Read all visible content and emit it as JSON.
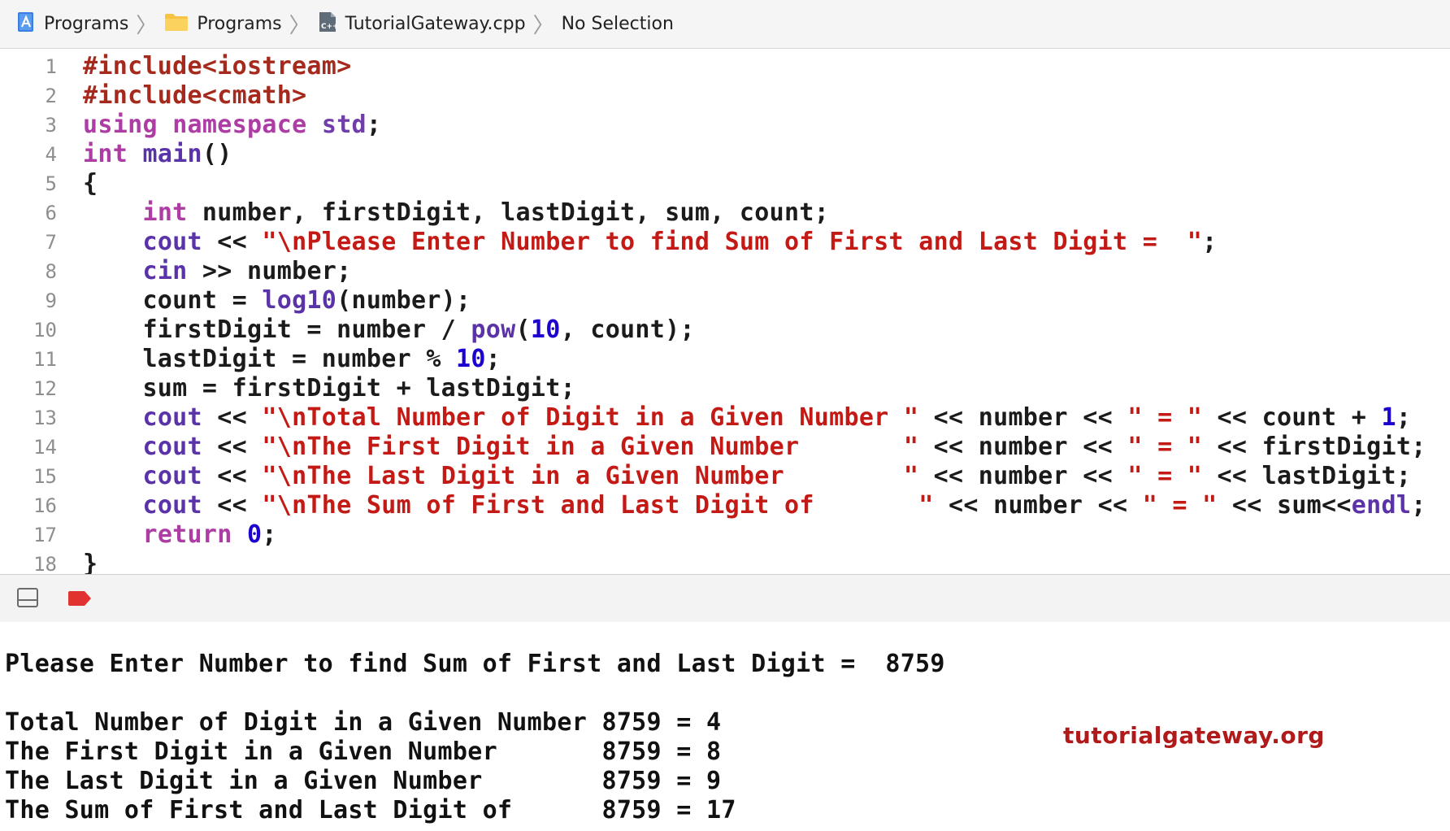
{
  "breadcrumb": {
    "items": [
      {
        "label": "Programs",
        "icon": "xcode-project-icon"
      },
      {
        "label": "Programs",
        "icon": "folder-icon"
      },
      {
        "label": "TutorialGateway.cpp",
        "icon": "cpp-file-icon"
      },
      {
        "label": "No Selection",
        "icon": ""
      }
    ],
    "separator": "〉"
  },
  "editor": {
    "line_numbers": [
      "1",
      "2",
      "3",
      "4",
      "5",
      "6",
      "7",
      "8",
      "9",
      "10",
      "11",
      "12",
      "13",
      "14",
      "15",
      "16",
      "17",
      "18"
    ],
    "lines": [
      [
        {
          "t": "#include<iostream>",
          "c": "hash"
        }
      ],
      [
        {
          "t": "#include<cmath>",
          "c": "hash"
        }
      ],
      [
        {
          "t": "using",
          "c": "kw"
        },
        {
          "t": " "
        },
        {
          "t": "namespace",
          "c": "kw"
        },
        {
          "t": " "
        },
        {
          "t": "std",
          "c": "typ"
        },
        {
          "t": ";"
        }
      ],
      [
        {
          "t": "int",
          "c": "kw"
        },
        {
          "t": " "
        },
        {
          "t": "main",
          "c": "fn"
        },
        {
          "t": "()"
        }
      ],
      [
        {
          "t": "{"
        }
      ],
      [
        {
          "t": "    "
        },
        {
          "t": "int",
          "c": "kw"
        },
        {
          "t": " number, firstDigit, lastDigit, sum, count;"
        }
      ],
      [
        {
          "t": "    "
        },
        {
          "t": "cout",
          "c": "fn"
        },
        {
          "t": " << "
        },
        {
          "t": "\"\\nPlease Enter Number to find Sum of First and Last Digit =  \"",
          "c": "str"
        },
        {
          "t": ";"
        }
      ],
      [
        {
          "t": "    "
        },
        {
          "t": "cin",
          "c": "fn"
        },
        {
          "t": " >> number;"
        }
      ],
      [
        {
          "t": "    count = "
        },
        {
          "t": "log10",
          "c": "fn"
        },
        {
          "t": "(number);"
        }
      ],
      [
        {
          "t": "    firstDigit = number / "
        },
        {
          "t": "pow",
          "c": "fn"
        },
        {
          "t": "("
        },
        {
          "t": "10",
          "c": "num"
        },
        {
          "t": ", count);"
        }
      ],
      [
        {
          "t": "    lastDigit = number % "
        },
        {
          "t": "10",
          "c": "num"
        },
        {
          "t": ";"
        }
      ],
      [
        {
          "t": "    sum = firstDigit + lastDigit;"
        }
      ],
      [
        {
          "t": "    "
        },
        {
          "t": "cout",
          "c": "fn"
        },
        {
          "t": " << "
        },
        {
          "t": "\"\\nTotal Number of Digit in a Given Number \"",
          "c": "str"
        },
        {
          "t": " << number << "
        },
        {
          "t": "\" = \"",
          "c": "str"
        },
        {
          "t": " << count + "
        },
        {
          "t": "1",
          "c": "num"
        },
        {
          "t": ";"
        }
      ],
      [
        {
          "t": "    "
        },
        {
          "t": "cout",
          "c": "fn"
        },
        {
          "t": " << "
        },
        {
          "t": "\"\\nThe First Digit in a Given Number       \"",
          "c": "str"
        },
        {
          "t": " << number << "
        },
        {
          "t": "\" = \"",
          "c": "str"
        },
        {
          "t": " << firstDigit;"
        }
      ],
      [
        {
          "t": "    "
        },
        {
          "t": "cout",
          "c": "fn"
        },
        {
          "t": " << "
        },
        {
          "t": "\"\\nThe Last Digit in a Given Number        \"",
          "c": "str"
        },
        {
          "t": " << number << "
        },
        {
          "t": "\" = \"",
          "c": "str"
        },
        {
          "t": " << lastDigit;"
        }
      ],
      [
        {
          "t": "    "
        },
        {
          "t": "cout",
          "c": "fn"
        },
        {
          "t": " << "
        },
        {
          "t": "\"\\nThe Sum of First and Last Digit of       \"",
          "c": "str"
        },
        {
          "t": " << number << "
        },
        {
          "t": "\" = \"",
          "c": "str"
        },
        {
          "t": " << sum<<"
        },
        {
          "t": "endl",
          "c": "fn"
        },
        {
          "t": ";"
        }
      ],
      [
        {
          "t": "    "
        },
        {
          "t": "return",
          "c": "kw"
        },
        {
          "t": " "
        },
        {
          "t": "0",
          "c": "num"
        },
        {
          "t": ";"
        }
      ],
      [
        {
          "t": "}"
        }
      ]
    ]
  },
  "debug_bar": {
    "toggle_icon": "panel-toggle-icon",
    "breakpoint_icon": "breakpoint-icon",
    "breakpoint_color": "#e0322e"
  },
  "console": {
    "lines": [
      "Please Enter Number to find Sum of First and Last Digit =  8759",
      "",
      "Total Number of Digit in a Given Number 8759 = 4",
      "The First Digit in a Given Number       8759 = 8",
      "The Last Digit in a Given Number        8759 = 9",
      "The Sum of First and Last Digit of      8759 = 17"
    ]
  },
  "watermark": "tutorialgateway.org",
  "colors": {
    "keyword": "#ad3da4",
    "string": "#c41a16",
    "number": "#1c00cf",
    "function": "#5b33a8",
    "preprocessor": "#a52a1d"
  }
}
